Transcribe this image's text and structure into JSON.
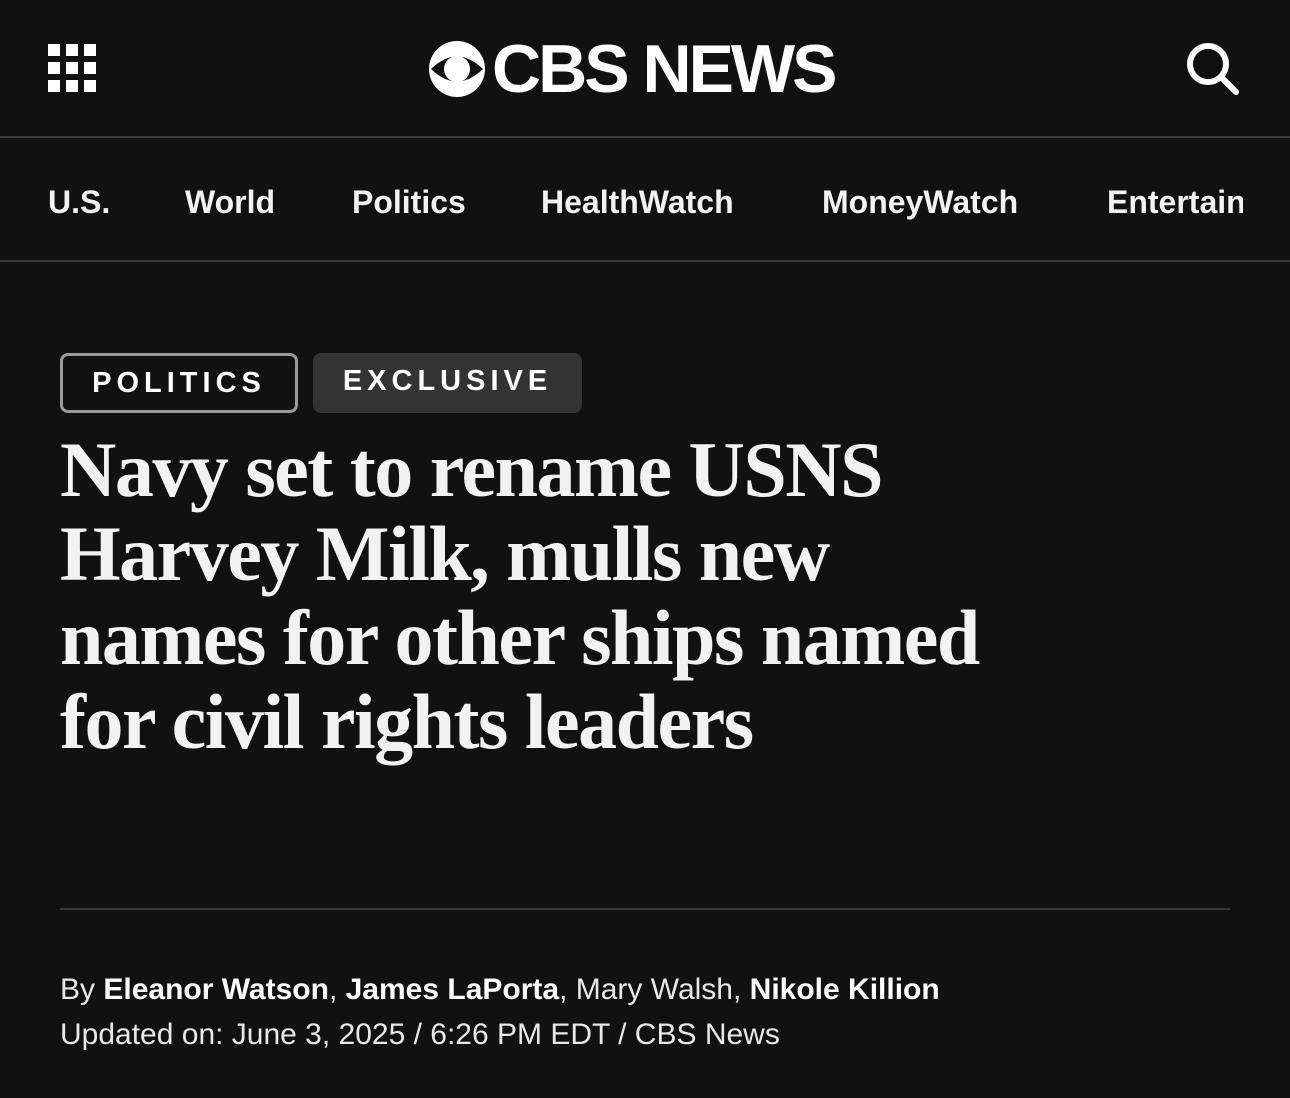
{
  "header": {
    "logo_text": "CBS NEWS",
    "menu_icon": "grid-menu-icon",
    "search_icon": "search-icon"
  },
  "nav": {
    "items": [
      {
        "label": "U.S."
      },
      {
        "label": "World"
      },
      {
        "label": "Politics"
      },
      {
        "label": "HealthWatch"
      },
      {
        "label": "MoneyWatch"
      },
      {
        "label": "Entertainment"
      }
    ]
  },
  "article": {
    "tags": [
      "POLITICS",
      "EXCLUSIVE"
    ],
    "headline": "Navy set to rename USNS Harvey Milk, mulls new names for other ships named for civil rights leaders",
    "byline": {
      "prefix": "By",
      "authors": [
        {
          "name": "Eleanor Watson",
          "bold": true
        },
        {
          "name": "James LaPorta",
          "bold": true
        },
        {
          "name": "Mary Walsh",
          "bold": false
        },
        {
          "name": "Nikole Killion",
          "bold": true
        }
      ]
    },
    "updated": "Updated on: June 3, 2025 / 6:26 PM EDT / CBS News"
  },
  "colors": {
    "background": "#111111",
    "text": "#ffffff",
    "divider": "#3a3a3a",
    "tag_border": "#9a9a9a",
    "tag_fill": "#333333"
  }
}
